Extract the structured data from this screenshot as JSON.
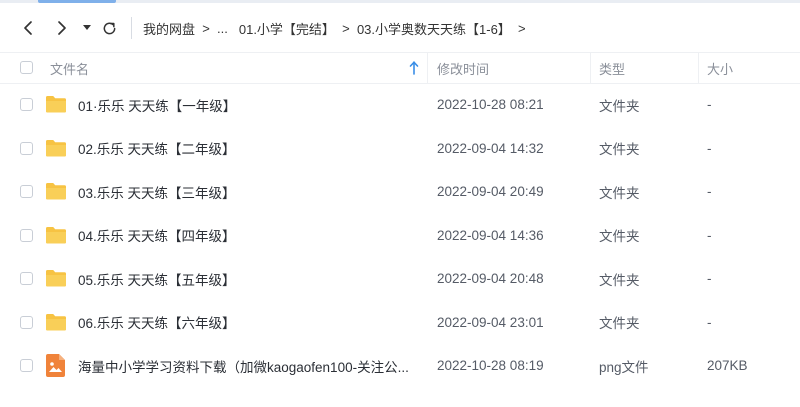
{
  "nav": {
    "back_icon": "chevron-left-icon",
    "forward_icon": "chevron-right-icon",
    "history_icon": "caret-down-icon",
    "refresh_icon": "refresh-icon"
  },
  "breadcrumb": {
    "root": "我的网盘",
    "separator": ">",
    "ellipsis": "...",
    "items": [
      "01.小学【完结】",
      "03.小学奥数天天练【1-6】"
    ]
  },
  "table": {
    "headers": {
      "name": "文件名",
      "modified": "修改时间",
      "type": "类型",
      "size": "大小"
    },
    "sort": {
      "column": "name",
      "direction": "ascending",
      "icon": "arrow-up-icon"
    },
    "rows": [
      {
        "name": "01·乐乐  天天练【一年级】",
        "modified": "2022-10-28 08:21",
        "type": "文件夹",
        "size": "-",
        "icon": "folder-icon"
      },
      {
        "name": "02.乐乐  天天练【二年级】",
        "modified": "2022-09-04 14:32",
        "type": "文件夹",
        "size": "-",
        "icon": "folder-icon"
      },
      {
        "name": "03.乐乐  天天练【三年级】",
        "modified": "2022-09-04 20:49",
        "type": "文件夹",
        "size": "-",
        "icon": "folder-icon"
      },
      {
        "name": "04.乐乐  天天练【四年级】",
        "modified": "2022-09-04 14:36",
        "type": "文件夹",
        "size": "-",
        "icon": "folder-icon"
      },
      {
        "name": "05.乐乐 天天练【五年级】",
        "modified": "2022-09-04 20:48",
        "type": "文件夹",
        "size": "-",
        "icon": "folder-icon"
      },
      {
        "name": "06.乐乐 天天练【六年级】",
        "modified": "2022-09-04 23:01",
        "type": "文件夹",
        "size": "-",
        "icon": "folder-icon"
      },
      {
        "name": "海量中小学学习资料下载（加微kaogaofen100-关注公...",
        "modified": "2022-10-28 08:19",
        "type": "png文件",
        "size": "207KB",
        "icon": "image-file-icon"
      }
    ]
  },
  "colors": {
    "folder": "#f7c343",
    "image_file": "#f0833a",
    "sort_arrow": "#3a8ee6",
    "header_text": "#8a8f99"
  }
}
